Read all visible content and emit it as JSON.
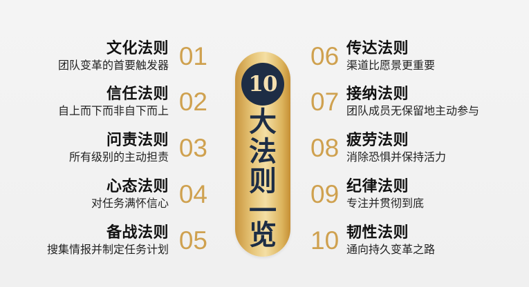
{
  "banner": {
    "number": "10",
    "chars": [
      "大",
      "法",
      "则",
      "一",
      "览"
    ]
  },
  "rules": [
    {
      "title": "文化法则",
      "desc": "团队变革的首要触发器",
      "num": "01"
    },
    {
      "title": "信任法则",
      "desc": "自上而下而非自下而上",
      "num": "02"
    },
    {
      "title": "问责法则",
      "desc": "所有级别的主动担责",
      "num": "03"
    },
    {
      "title": "心态法则",
      "desc": "对任务满怀信心",
      "num": "04"
    },
    {
      "title": "备战法则",
      "desc": "搜集情报并制定任务计划",
      "num": "05"
    },
    {
      "title": "传达法则",
      "desc": "渠道比愿景更重要",
      "num": "06"
    },
    {
      "title": "接纳法则",
      "desc": "团队成员无保留地主动参与",
      "num": "07"
    },
    {
      "title": "疲劳法则",
      "desc": "消除恐惧并保持活力",
      "num": "08"
    },
    {
      "title": "纪律法则",
      "desc": "专注并贯彻到底",
      "num": "09"
    },
    {
      "title": "韧性法则",
      "desc": "通向持久变革之路",
      "num": "10"
    }
  ]
}
